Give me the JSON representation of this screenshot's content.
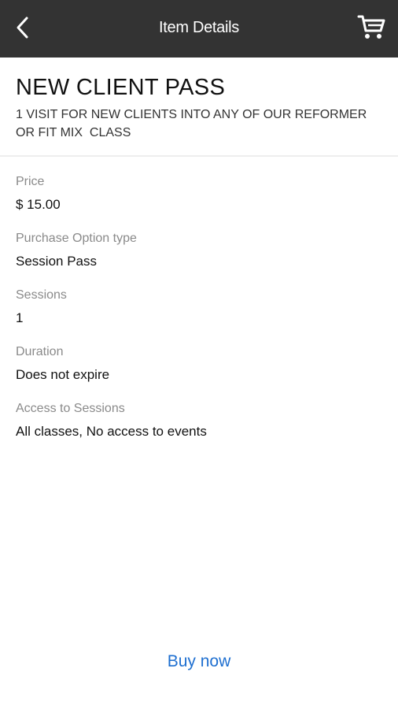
{
  "header": {
    "title": "Item Details",
    "back_icon": "chevron-left-icon",
    "cart_icon": "shopping-cart-icon"
  },
  "item": {
    "name": "NEW CLIENT PASS",
    "description": "1 VISIT FOR NEW CLIENTS INTO ANY OF OUR REFORMER\nOR FIT MIX  CLASS"
  },
  "details": [
    {
      "label": "Price",
      "value": "$ 15.00"
    },
    {
      "label": "Purchase Option type",
      "value": "Session Pass"
    },
    {
      "label": "Sessions",
      "value": "1"
    },
    {
      "label": "Duration",
      "value": "Does not expire"
    },
    {
      "label": "Access to Sessions",
      "value": "All classes, No access to events"
    }
  ],
  "actions": {
    "buy_label": "Buy now"
  },
  "colors": {
    "topbar": "#333333",
    "accent": "#1e6fd0"
  }
}
